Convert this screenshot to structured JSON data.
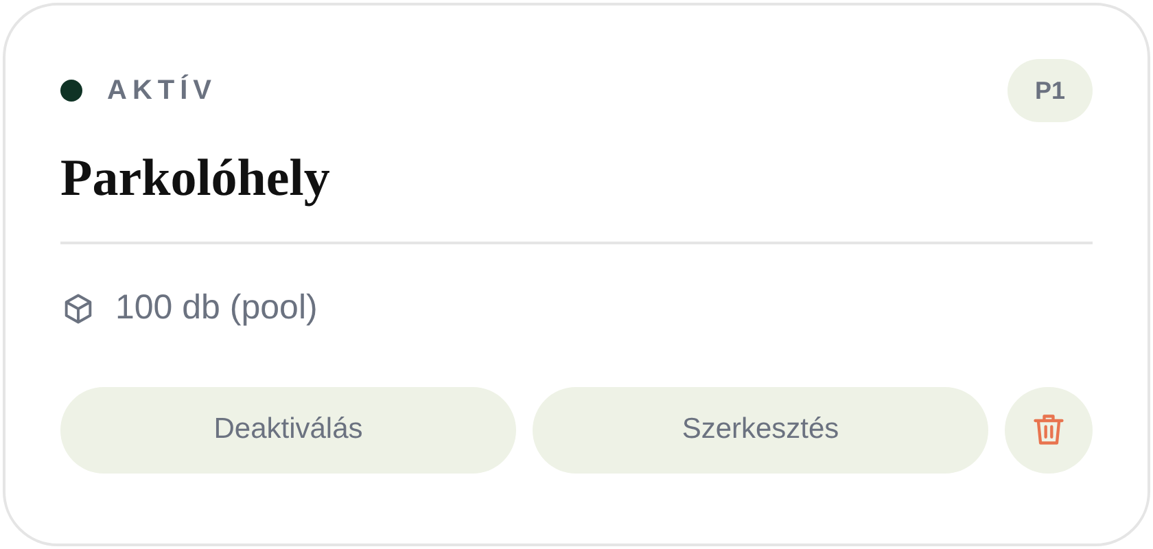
{
  "status": {
    "label": "AKTÍV",
    "active": true
  },
  "badge": "P1",
  "title": "Parkolóhely",
  "info": {
    "text": "100 db (pool)"
  },
  "buttons": [
    {
      "kind": "text",
      "label": "Deaktiválás"
    },
    {
      "kind": "text",
      "label": "Szerkesztés"
    },
    {
      "kind": "delete"
    }
  ]
}
